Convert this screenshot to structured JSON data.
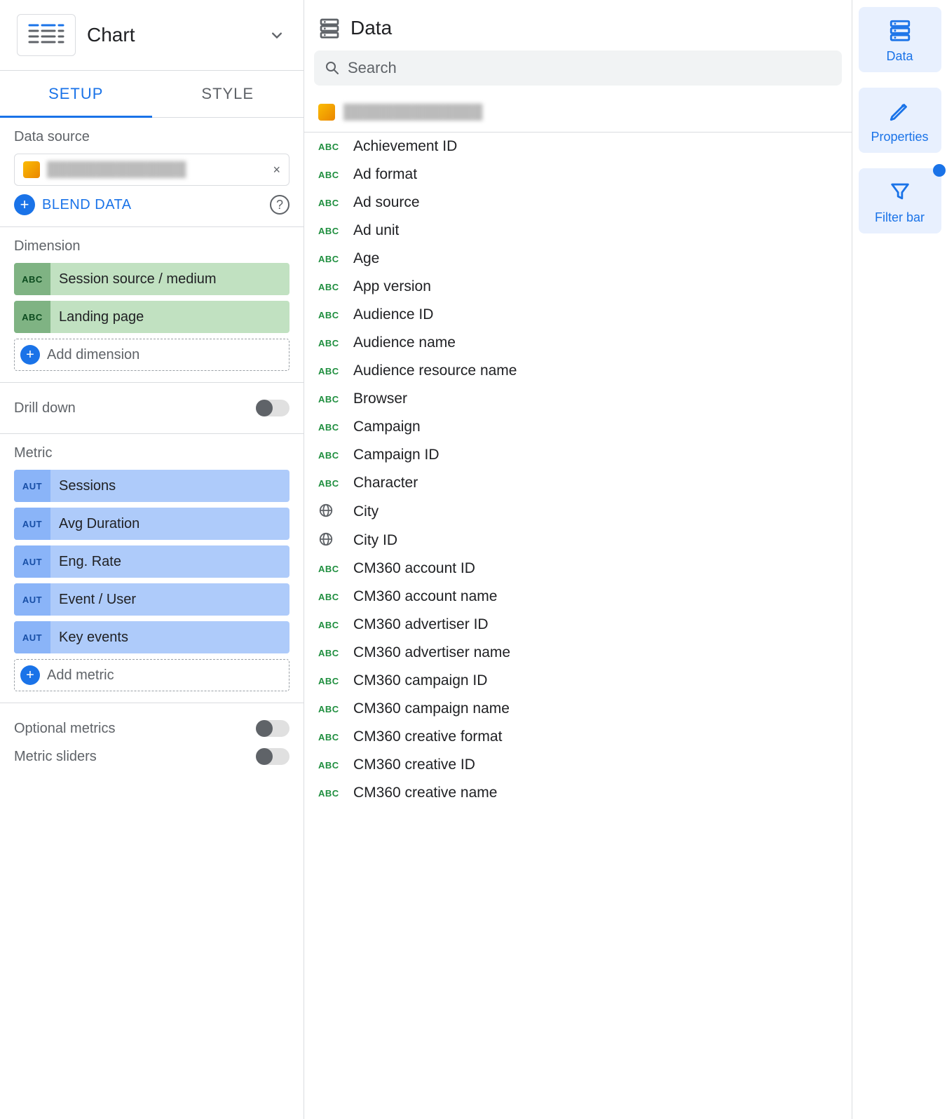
{
  "header": {
    "title": "Chart"
  },
  "tabs": {
    "setup": "SETUP",
    "style": "STYLE"
  },
  "datasource": {
    "label": "Data source",
    "name_placeholder": "██████████████",
    "blend": "BLEND DATA"
  },
  "dimension": {
    "label": "Dimension",
    "items": [
      {
        "badge": "ABC",
        "label": "Session source / medium"
      },
      {
        "badge": "ABC",
        "label": "Landing page"
      }
    ],
    "add": "Add dimension"
  },
  "drilldown": {
    "label": "Drill down"
  },
  "metric": {
    "label": "Metric",
    "items": [
      {
        "badge": "AUT",
        "label": "Sessions"
      },
      {
        "badge": "AUT",
        "label": "Avg Duration"
      },
      {
        "badge": "AUT",
        "label": "Eng. Rate"
      },
      {
        "badge": "AUT",
        "label": "Event / User"
      },
      {
        "badge": "AUT",
        "label": "Key events"
      }
    ],
    "add": "Add metric"
  },
  "optional_metrics": {
    "label": "Optional metrics"
  },
  "metric_sliders": {
    "label": "Metric sliders"
  },
  "datapanel": {
    "title": "Data",
    "search_placeholder": "Search",
    "source_placeholder": "██████████████",
    "fields": [
      {
        "type": "ABC",
        "label": "Achievement ID"
      },
      {
        "type": "ABC",
        "label": "Ad format"
      },
      {
        "type": "ABC",
        "label": "Ad source"
      },
      {
        "type": "ABC",
        "label": "Ad unit"
      },
      {
        "type": "ABC",
        "label": "Age"
      },
      {
        "type": "ABC",
        "label": "App version"
      },
      {
        "type": "ABC",
        "label": "Audience ID"
      },
      {
        "type": "ABC",
        "label": "Audience name"
      },
      {
        "type": "ABC",
        "label": "Audience resource name"
      },
      {
        "type": "ABC",
        "label": "Browser"
      },
      {
        "type": "ABC",
        "label": "Campaign"
      },
      {
        "type": "ABC",
        "label": "Campaign ID"
      },
      {
        "type": "ABC",
        "label": "Character"
      },
      {
        "type": "GEO",
        "label": "City"
      },
      {
        "type": "GEO",
        "label": "City ID"
      },
      {
        "type": "ABC",
        "label": "CM360 account ID"
      },
      {
        "type": "ABC",
        "label": "CM360 account name"
      },
      {
        "type": "ABC",
        "label": "CM360 advertiser ID"
      },
      {
        "type": "ABC",
        "label": "CM360 advertiser name"
      },
      {
        "type": "ABC",
        "label": "CM360 campaign ID"
      },
      {
        "type": "ABC",
        "label": "CM360 campaign name"
      },
      {
        "type": "ABC",
        "label": "CM360 creative format"
      },
      {
        "type": "ABC",
        "label": "CM360 creative ID"
      },
      {
        "type": "ABC",
        "label": "CM360 creative name"
      }
    ]
  },
  "rail": {
    "data": "Data",
    "properties": "Properties",
    "filterbar": "Filter bar"
  }
}
